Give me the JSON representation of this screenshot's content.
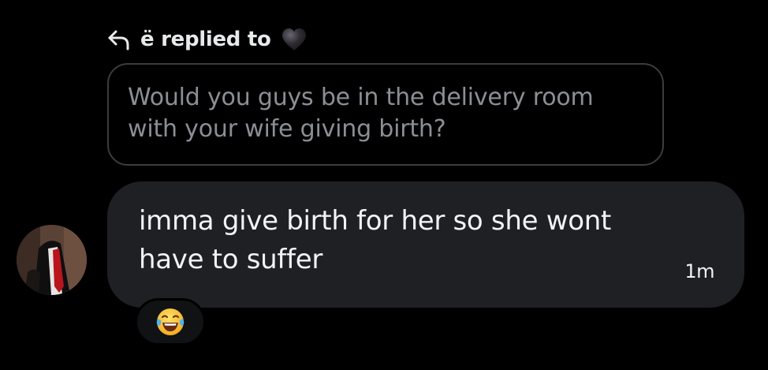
{
  "reply_header": {
    "label": "ë replied to",
    "reply_icon": "reply-arrow-icon",
    "target_icon": "black-heart-icon"
  },
  "quoted_message": {
    "text": "Would you guys be in the delivery room with your wife giving birth?"
  },
  "message": {
    "avatar": "user-avatar",
    "text": "imma give birth for her so she wont have to suffer",
    "timestamp": "1m"
  },
  "reaction": {
    "emoji": "face-with-tears-of-joy-icon"
  },
  "colors": {
    "background": "#000000",
    "bubble": "#1f2023",
    "quoted_border": "#3a3c40",
    "quoted_text": "#8b8f94",
    "text": "#f2f3f4"
  }
}
